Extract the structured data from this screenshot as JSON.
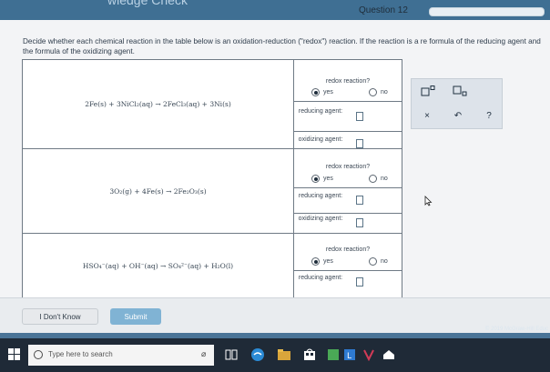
{
  "header": {
    "title_fragment": "wledge Check",
    "question_label": "Question 12"
  },
  "prompt": {
    "text": "Decide whether each chemical reaction in the table below is an oxidation-reduction (\"redox\") reaction. If the reaction is a re formula of the reducing agent and the formula of the oxidizing agent."
  },
  "table": {
    "rows": [
      {
        "equation": "2Fe(s) + 3NiCl₂(aq) → 2FeCl₃(aq) + 3Ni(s)",
        "redox_label": "redox reaction?",
        "yes_label": "yes",
        "no_label": "no",
        "reducing_label": "reducing agent:",
        "oxidizing_label": "oxidizing agent:"
      },
      {
        "equation": "3O₂(g) + 4Fe(s) → 2Fe₂O₃(s)",
        "redox_label": "redox reaction?",
        "yes_label": "yes",
        "no_label": "no",
        "reducing_label": "reducing agent:",
        "oxidizing_label": "oxidizing agent:"
      },
      {
        "equation": "HSO₄⁻(aq) + OH⁻(aq) → SO₄²⁻(aq) + H₂O(l)",
        "redox_label": "redox reaction?",
        "yes_label": "yes",
        "no_label": "no",
        "reducing_label": "reducing agent:"
      }
    ]
  },
  "tools": {
    "clear_symbol": "×",
    "undo_symbol": "↶",
    "help_symbol": "?"
  },
  "footer": {
    "dont_know": "I Don't Know",
    "submit": "Submit",
    "copyright": "© 2019 McGraw-Hill Educ"
  },
  "taskbar": {
    "search_placeholder": "Type here to search"
  },
  "colors": {
    "accent": "#3f6f93",
    "submit": "#80b3d4",
    "taskbar": "#1f2a37"
  }
}
